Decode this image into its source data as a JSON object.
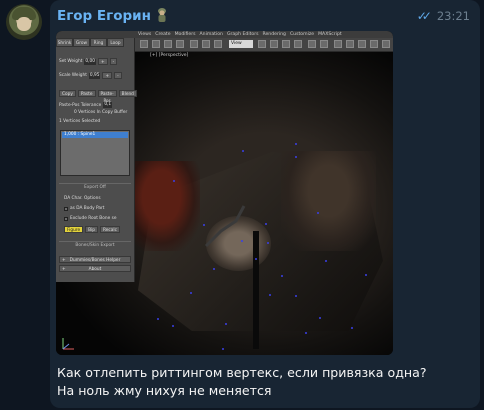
{
  "message": {
    "author": "Егор Егорин",
    "time": "23:21",
    "text": "Как отлепить риттингом вертекс, если привязка одна? На ноль жму нихуя не меняется",
    "status_icon": "double-check-icon",
    "colors": {
      "bubble": "#182533",
      "author": "#6ab3f3",
      "background": "#0e1621",
      "check": "#5fa8e8"
    }
  },
  "screenshot": {
    "menu_items": [
      "Views",
      "Create",
      "Modifiers",
      "Animation",
      "Graph Editors",
      "Rendering",
      "Customize",
      "MAXScript"
    ],
    "view_select": "View",
    "viewport_label": "[+] [Perspective]",
    "panel": {
      "tabs": [
        "Shrink",
        "Grow",
        "Ring",
        "Loop"
      ],
      "set_weight_label": "Set Weight",
      "set_weight_value": "0,00",
      "scale_weight_label": "Scale Weight",
      "scale_weight_value": "0,95",
      "buttons_copy": [
        "Copy",
        "Paste",
        "Paste-Pos",
        "Blend"
      ],
      "paste_pos_tolerance_label": "Paste-Pos Tolerance",
      "paste_pos_tolerance_value": "0,1",
      "vertices_in_copy_buffer": "0 Vertices In Copy Buffer",
      "vertices_selected": "1 Vertices Selected",
      "list_item": "1,000 : Spine1",
      "export_label": "Export Off",
      "options": [
        "DA Char. Options",
        "as DA Body Part",
        "Exclude Root Bone se"
      ],
      "bottom_buttons": [
        "Figure",
        "Bip",
        "Recalc"
      ],
      "bones_skin_export": "Bones/Skin Export",
      "rollouts": [
        "Dummies/Bones Helper",
        "About"
      ]
    }
  }
}
